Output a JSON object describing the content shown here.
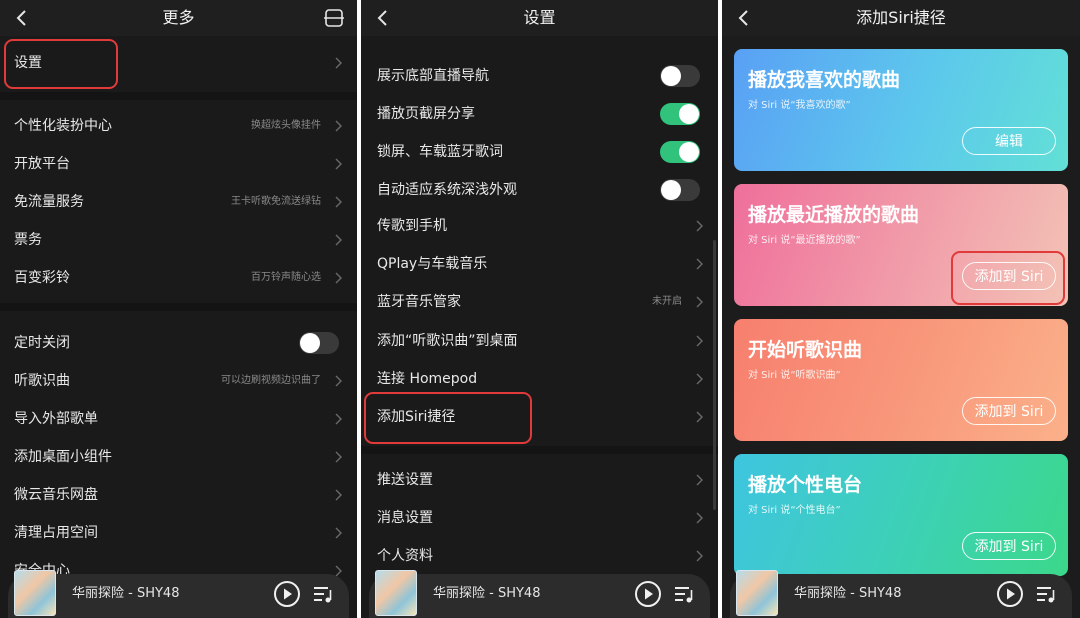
{
  "colors": {
    "accent_green": "#31c27c",
    "highlight_red": "#e03a3a",
    "panel_bg": "#1a1a1a"
  },
  "panel1": {
    "title": "更多",
    "rows": [
      {
        "label": "设置",
        "hint": ""
      },
      {
        "label": "个性化装扮中心",
        "hint": "换超炫头像挂件"
      },
      {
        "label": "开放平台",
        "hint": ""
      },
      {
        "label": "免流量服务",
        "hint": "王卡听歌免流送绿钻"
      },
      {
        "label": "票务",
        "hint": ""
      },
      {
        "label": "百变彩铃",
        "hint": "百万铃声随心选"
      },
      {
        "label": "定时关闭",
        "hint": ""
      },
      {
        "label": "听歌识曲",
        "hint": "可以边刷视频边识曲了"
      },
      {
        "label": "导入外部歌单",
        "hint": ""
      },
      {
        "label": "添加桌面小组件",
        "hint": ""
      },
      {
        "label": "微云音乐网盘",
        "hint": ""
      },
      {
        "label": "清理占用空间",
        "hint": ""
      },
      {
        "label": "安全中心",
        "hint": ""
      }
    ],
    "timer_toggle": false
  },
  "panel2": {
    "title": "设置",
    "rows": [
      {
        "label": "展示底部直播导航",
        "hint": "",
        "toggle": false
      },
      {
        "label": "播放页截屏分享",
        "hint": "",
        "toggle": true
      },
      {
        "label": "锁屏、车载蓝牙歌词",
        "hint": "",
        "toggle": true
      },
      {
        "label": "自动适应系统深浅外观",
        "hint": "",
        "toggle": false
      },
      {
        "label": "传歌到手机",
        "hint": ""
      },
      {
        "label": "QPlay与车载音乐",
        "hint": ""
      },
      {
        "label": "蓝牙音乐管家",
        "hint": "未开启"
      },
      {
        "label": "添加“听歌识曲”到桌面",
        "hint": ""
      },
      {
        "label": "连接 Homepod",
        "hint": ""
      },
      {
        "label": "添加Siri捷径",
        "hint": ""
      },
      {
        "label": "推送设置",
        "hint": ""
      },
      {
        "label": "消息设置",
        "hint": ""
      },
      {
        "label": "个人资料",
        "hint": ""
      }
    ]
  },
  "panel3": {
    "title": "添加Siri捷径",
    "cards": [
      {
        "title": "播放我喜欢的歌曲",
        "subtitle": "对 Siri 说“我喜欢的歌”",
        "button": "编辑"
      },
      {
        "title": "播放最近播放的歌曲",
        "subtitle": "对 Siri 说“最近播放的歌”",
        "button": "添加到 Siri"
      },
      {
        "title": "开始听歌识曲",
        "subtitle": "对 Siri 说“听歌识曲”",
        "button": "添加到 Siri"
      },
      {
        "title": "播放个性电台",
        "subtitle": "对 Siri 说“个性电台”",
        "button": "添加到 Siri"
      }
    ]
  },
  "player": {
    "song": "华丽探险 - SHY48"
  },
  "icons": {
    "back": "chevron-left-icon",
    "scan": "scan-icon",
    "play": "play-circle-icon",
    "playlist": "playlist-icon",
    "chevron": "chevron-right-icon"
  }
}
